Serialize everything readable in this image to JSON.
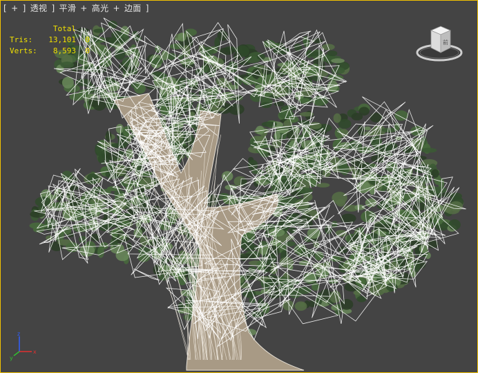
{
  "viewport": {
    "label_parts": [
      "[",
      "+",
      "]",
      "透视",
      "]",
      "平滑",
      "+",
      "高光",
      "+",
      "边面",
      "]"
    ],
    "border_color": "#f2c200",
    "background": "#444444"
  },
  "stats": {
    "header": "Total",
    "rows": [
      {
        "key": "Tris:",
        "total": "13,101",
        "selected": "0"
      },
      {
        "key": "Verts:",
        "total": "8,593",
        "selected": "0"
      }
    ],
    "color": "#f0e000"
  },
  "viewcube": {
    "face_label": "前",
    "icon": "viewcube-icon"
  },
  "axis_gizmo": {
    "icon": "axis-tripod-icon",
    "x_label": "x",
    "y_label": "y",
    "z_label": "z",
    "x_color": "#e03030",
    "y_color": "#30c030",
    "z_color": "#3060ff"
  }
}
